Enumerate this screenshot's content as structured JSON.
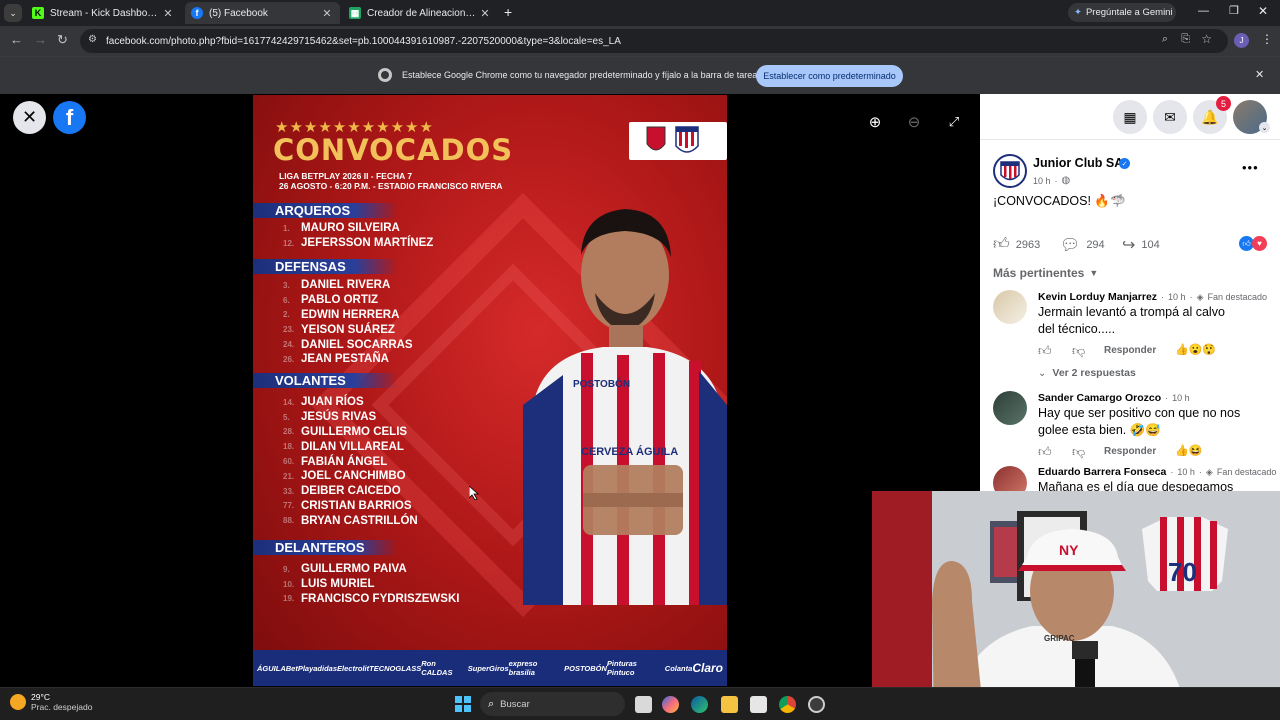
{
  "browser": {
    "tabs": [
      {
        "title": "Stream - Kick Dashboard",
        "favicon_color": "#53fc18",
        "favicon_letter": "K"
      },
      {
        "title": "(5) Facebook",
        "favicon_color": "#1877f2",
        "favicon_letter": "f"
      },
      {
        "title": "Creador de Alineaciones - Form",
        "favicon_color": "#1fa463",
        "favicon_letter": "▦"
      }
    ],
    "gemini_label": "Pregúntale a Gemini",
    "url": "facebook.com/photo.php?fbid=1617742429715462&set=pb.100044391610987.-2207520000&type=3&locale=es_LA",
    "infobar_text": "Establece Google Chrome como tu navegador predeterminado y fíjalo a la barra de tareas",
    "infobar_button": "Establecer como predeterminado"
  },
  "poster": {
    "stars": "★★★★★★★★★★★",
    "title": "CONVOCADOS",
    "subtitle1": "LIGA BETPLAY 2026 II - FECHA 7",
    "subtitle2": "26 AGOSTO - 6:20 P.M. - ESTADIO FRANCISCO RIVERA",
    "sections": [
      {
        "name": "ARQUEROS",
        "players": [
          {
            "num": "1.",
            "name": "MAURO SILVEIRA"
          },
          {
            "num": "12.",
            "name": "JEFERSSON MARTÍNEZ"
          }
        ]
      },
      {
        "name": "DEFENSAS",
        "players": [
          {
            "num": "3.",
            "name": "DANIEL RIVERA"
          },
          {
            "num": "6.",
            "name": "PABLO ORTIZ"
          },
          {
            "num": "2.",
            "name": "EDWIN HERRERA"
          },
          {
            "num": "23.",
            "name": "YEISON SUÁREZ"
          },
          {
            "num": "24.",
            "name": "DANIEL SOCARRAS"
          },
          {
            "num": "26.",
            "name": "JEAN PESTAÑA"
          }
        ]
      },
      {
        "name": "VOLANTES",
        "players": [
          {
            "num": "14.",
            "name": "JUAN RÍOS"
          },
          {
            "num": "5.",
            "name": "JESÚS RIVAS"
          },
          {
            "num": "28.",
            "name": "GUILLERMO CELIS"
          },
          {
            "num": "18.",
            "name": "DILAN VILLAREAL"
          },
          {
            "num": "60.",
            "name": "FABIÁN ÁNGEL"
          },
          {
            "num": "21.",
            "name": "JOEL CANCHIMBO"
          },
          {
            "num": "33.",
            "name": "DEIBER CAICEDO"
          },
          {
            "num": "77.",
            "name": "CRISTIAN BARRIOS"
          },
          {
            "num": "88.",
            "name": "BRYAN CASTRILLÓN"
          }
        ]
      },
      {
        "name": "DELANTEROS",
        "players": [
          {
            "num": "9.",
            "name": "GUILLERMO PAIVA"
          },
          {
            "num": "10.",
            "name": "LUIS MURIEL"
          },
          {
            "num": "19.",
            "name": "FRANCISCO FYDRISZEWSKI"
          }
        ]
      }
    ],
    "jersey_text1": "POSTOBÓN",
    "jersey_text2": "CERVEZA ÁGUILA",
    "sponsors": [
      "ÁGUILA",
      "BetPlay",
      "adidas",
      "Electrolit",
      "TECNOGLASS",
      "Ron CALDAS",
      "SuperGiros",
      "expreso brasilia",
      "POSTOBÓN",
      "Pinturas Pintuco",
      "Colanta",
      "Claro"
    ]
  },
  "post": {
    "page_name": "Junior Club SA",
    "time": "10 h",
    "caption": "¡CONVOCADOS! 🔥🦈",
    "likes": "2963",
    "comments": "294",
    "shares": "104",
    "filter_label": "Más pertinentes",
    "notifications_count": "5",
    "comments_list": [
      {
        "author": "Kevin Lorduy Manjarrez",
        "time": "10 h",
        "badge": "Fan destacado",
        "text": "Jermain levantó a trompá al calvo del técnico.....",
        "reply": "Responder",
        "view_replies": "Ver 2 respuestas"
      },
      {
        "author": "Sander Camargo Orozco",
        "time": "10 h",
        "badge": "",
        "text": "Hay que ser positivo con que no nos golee esta bien. 🤣😅",
        "reply": "Responder"
      },
      {
        "author": "Eduardo Barrera Fonseca",
        "time": "10 h",
        "badge": "Fan destacado",
        "text": "Mañana es el día que despegamos"
      }
    ]
  },
  "taskbar": {
    "temp": "29°C",
    "weather": "Prac. despejado",
    "search_placeholder": "Buscar"
  },
  "webcam": {
    "jersey_number": "70",
    "cap_text": "NY",
    "shirt_text": "GRIPAC"
  }
}
